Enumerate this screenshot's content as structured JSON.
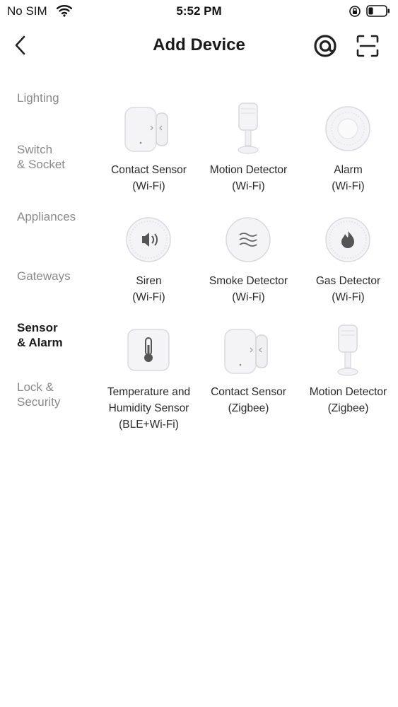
{
  "status_bar": {
    "carrier": "No SIM",
    "time": "5:52 PM"
  },
  "header": {
    "title": "Add Device"
  },
  "sidebar": {
    "items": [
      {
        "label": "Lighting",
        "active": false
      },
      {
        "label": "Switch\n& Socket",
        "active": false
      },
      {
        "label": "Appliances",
        "active": false
      },
      {
        "label": "Gateways",
        "active": false
      },
      {
        "label": "Sensor\n& Alarm",
        "active": true
      },
      {
        "label": "Lock &\nSecurity",
        "active": false
      }
    ]
  },
  "devices": [
    {
      "name": "Contact Sensor",
      "protocol": "(Wi-Fi)",
      "icon": "contact-sensor-icon"
    },
    {
      "name": "Motion Detector",
      "protocol": "(Wi-Fi)",
      "icon": "motion-detector-icon"
    },
    {
      "name": "Alarm",
      "protocol": "(Wi-Fi)",
      "icon": "alarm-icon"
    },
    {
      "name": "Siren",
      "protocol": "(Wi-Fi)",
      "icon": "siren-icon"
    },
    {
      "name": "Smoke Detector",
      "protocol": "(Wi-Fi)",
      "icon": "smoke-detector-icon"
    },
    {
      "name": "Gas Detector",
      "protocol": "(Wi-Fi)",
      "icon": "gas-detector-icon"
    },
    {
      "name": "Temperature and\nHumidity Sensor",
      "protocol": "(BLE+Wi-Fi)",
      "icon": "thermometer-icon"
    },
    {
      "name": "Contact Sensor",
      "protocol": "(Zigbee)",
      "icon": "contact-sensor-icon"
    },
    {
      "name": "Motion Detector",
      "protocol": "(Zigbee)",
      "icon": "motion-detector-icon"
    }
  ],
  "colors": {
    "active_text": "#1b1b1b",
    "inactive_text": "#8a8a8a",
    "background": "#ffffff"
  }
}
